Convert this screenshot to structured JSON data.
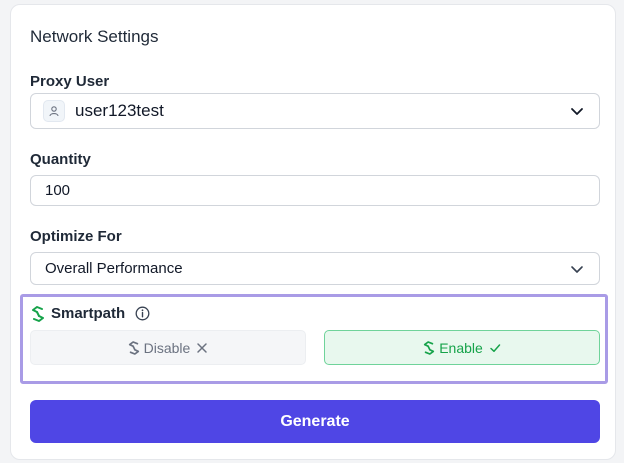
{
  "card": {
    "title": "Network Settings"
  },
  "proxy_user": {
    "label": "Proxy User",
    "value": "user123test"
  },
  "quantity": {
    "label": "Quantity",
    "value": "100"
  },
  "optimize": {
    "label": "Optimize For",
    "value": "Overall Performance"
  },
  "smartpath": {
    "title": "Smartpath",
    "disable_label": "Disable",
    "enable_label": "Enable",
    "selected": "Enable"
  },
  "actions": {
    "generate_label": "Generate"
  },
  "colors": {
    "accent": "#4f46e5",
    "smartpath_green": "#16a34a",
    "highlight_border": "#a99be6"
  }
}
